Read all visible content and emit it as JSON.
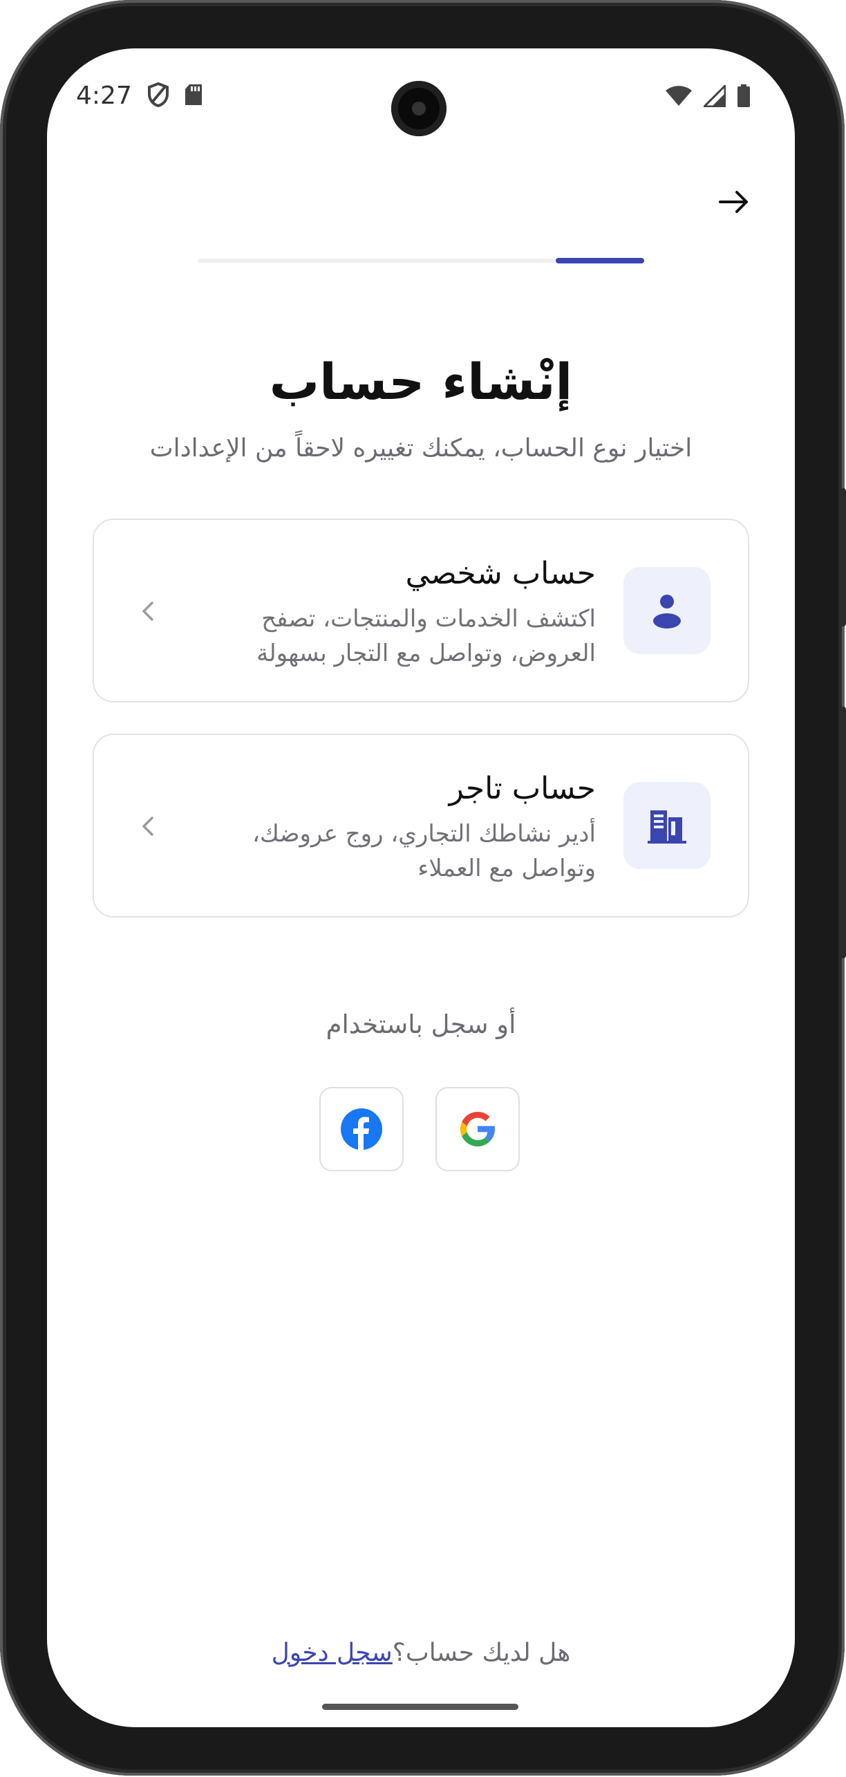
{
  "status_bar": {
    "time": "4:27"
  },
  "header": {
    "back_icon": "arrow-right-icon",
    "progress_value": 0.2
  },
  "page": {
    "title": "إنْشاء حساب",
    "subtitle": "اختيار نوع الحساب، يمكنك تغييره لاحقاً من الإعدادات"
  },
  "account_types": [
    {
      "title": "حساب شخصي",
      "description": "اكتشف الخدمات والمنتجات، تصفح العروض، وتواصل مع التجار بسهولة",
      "icon": "person-icon"
    },
    {
      "title": "حساب تاجر",
      "description": "أدير نشاطك التجاري، روج عروضك، وتواصل مع العملاء",
      "icon": "building-icon"
    }
  ],
  "social": {
    "label": "أو سجل باستخدام",
    "providers": [
      "facebook",
      "google"
    ]
  },
  "footer": {
    "question": "هل لديك حساب؟",
    "link": "سجل دخول"
  },
  "colors": {
    "accent": "#3b45b0",
    "icon_bg": "#eef0fb"
  }
}
